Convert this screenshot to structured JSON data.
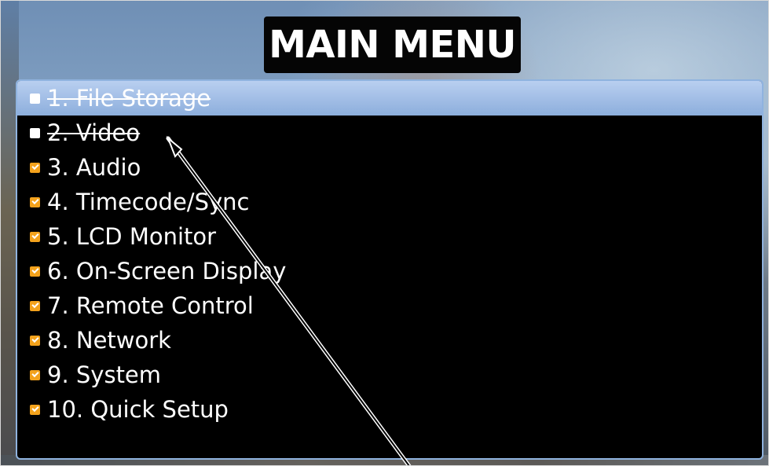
{
  "title": "MAIN MENU",
  "menu": {
    "items": [
      {
        "label": "1. File Storage",
        "checked": false,
        "disabled": true,
        "selected": true
      },
      {
        "label": "2. Video",
        "checked": false,
        "disabled": true,
        "selected": false
      },
      {
        "label": "3. Audio",
        "checked": true,
        "disabled": false,
        "selected": false
      },
      {
        "label": "4. Timecode/Sync",
        "checked": true,
        "disabled": false,
        "selected": false
      },
      {
        "label": "5. LCD Monitor",
        "checked": true,
        "disabled": false,
        "selected": false
      },
      {
        "label": "6. On-Screen Display",
        "checked": true,
        "disabled": false,
        "selected": false
      },
      {
        "label": "7. Remote Control",
        "checked": true,
        "disabled": false,
        "selected": false
      },
      {
        "label": "8. Network",
        "checked": true,
        "disabled": false,
        "selected": false
      },
      {
        "label": "9. System",
        "checked": true,
        "disabled": false,
        "selected": false
      },
      {
        "label": "10. Quick Setup",
        "checked": true,
        "disabled": false,
        "selected": false
      }
    ]
  },
  "colors": {
    "panel_border": "#8fb3df",
    "selected_highlight": "#8caedc",
    "checkbox_checked": "#f3a21c",
    "checkbox_unchecked": "#ffffff"
  }
}
